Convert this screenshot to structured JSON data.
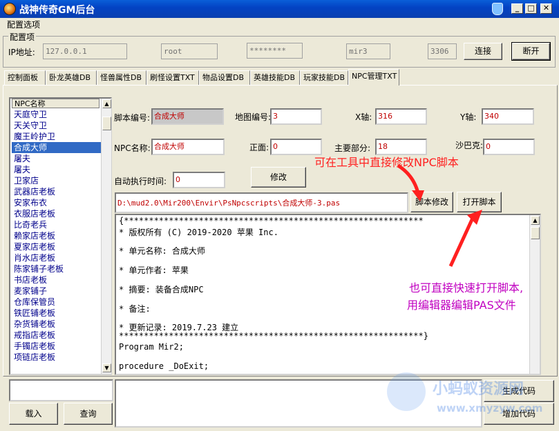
{
  "window": {
    "title": "战神传奇GM后台",
    "min": "_",
    "max": "□",
    "close": "✕"
  },
  "menu": {
    "config": "配置选项"
  },
  "config_group": {
    "label": "配置项",
    "ip_label": "IP地址:",
    "ip_value": "127.0.0.1",
    "user_value": "root",
    "password_value": "********",
    "db_value": "mir3",
    "port_value": "3306",
    "connect": "连接",
    "disconnect": "断开"
  },
  "tabs": [
    "控制面板",
    "卧龙英雄DB",
    "怪兽属性DB",
    "刷怪设置TXT",
    "物品设置DB",
    "英雄技能DB",
    "玩家技能DB",
    "NPC管理TXT"
  ],
  "npc_list": {
    "header": "NPC名称",
    "items": [
      "天庭守卫",
      "天关守卫",
      "魔王岭护卫",
      "合成大师",
      "屠夫",
      "屠夫",
      "卫家店",
      "武器店老板",
      "安家布衣",
      "衣服店老板",
      "比奇老兵",
      "赖家店老板",
      "夏家店老板",
      "肖水店老板",
      "陈家铺子老板",
      "书店老板",
      "麦家铺子",
      "仓库保管员",
      "铁匠铺老板",
      "杂货铺老板",
      "戒指店老板",
      "手镯店老板",
      "项链店老板"
    ],
    "selected_index": 3
  },
  "form": {
    "script_id_label": "脚本编号:",
    "script_id_value": "合成大师",
    "map_id_label": "地图编号:",
    "map_id_value": "3",
    "x_label": "X轴:",
    "x_value": "316",
    "y_label": "Y轴:",
    "y_value": "340",
    "npc_name_label": "NPC名称:",
    "npc_name_value": "合成大师",
    "front_label": "正面:",
    "front_value": "0",
    "main_part_label": "主要部分:",
    "main_part_value": "18",
    "sabak_label": "沙巴克:",
    "sabak_value": "0",
    "auto_time_label": "自动执行时间:",
    "auto_time_value": "0",
    "modify": "修改",
    "script_path": "D:\\mud2.0\\Mir200\\Envir\\PsNpcscripts\\合成大师-3.pas",
    "edit_script": "脚本修改",
    "open_script": "打开脚本"
  },
  "memo_lines": [
    "{************************************************************",
    "* 版权所有 (C) 2019-2020 苹果 Inc.",
    "* 单元名称: 合成大师",
    "* 单元作者: 苹果",
    "* 摘要: 装备合成NPC",
    "* 备注:",
    "* 更新记录: 2019.7.23 建立",
    "*************************************************************}",
    "Program Mir2;",
    "procedure _DoExit;"
  ],
  "annotations": {
    "top": "可在工具中直接修改NPC脚本",
    "right_line1": "也可直接快速打开脚本,",
    "right_line2": "用编辑器编辑PAS文件"
  },
  "bottom": {
    "load": "载入",
    "query": "查询",
    "generate": "生成代码",
    "add": "增加代码"
  },
  "watermark": {
    "text1": "小蚂蚁资源网",
    "text2": "www.xmyzyw.com"
  }
}
